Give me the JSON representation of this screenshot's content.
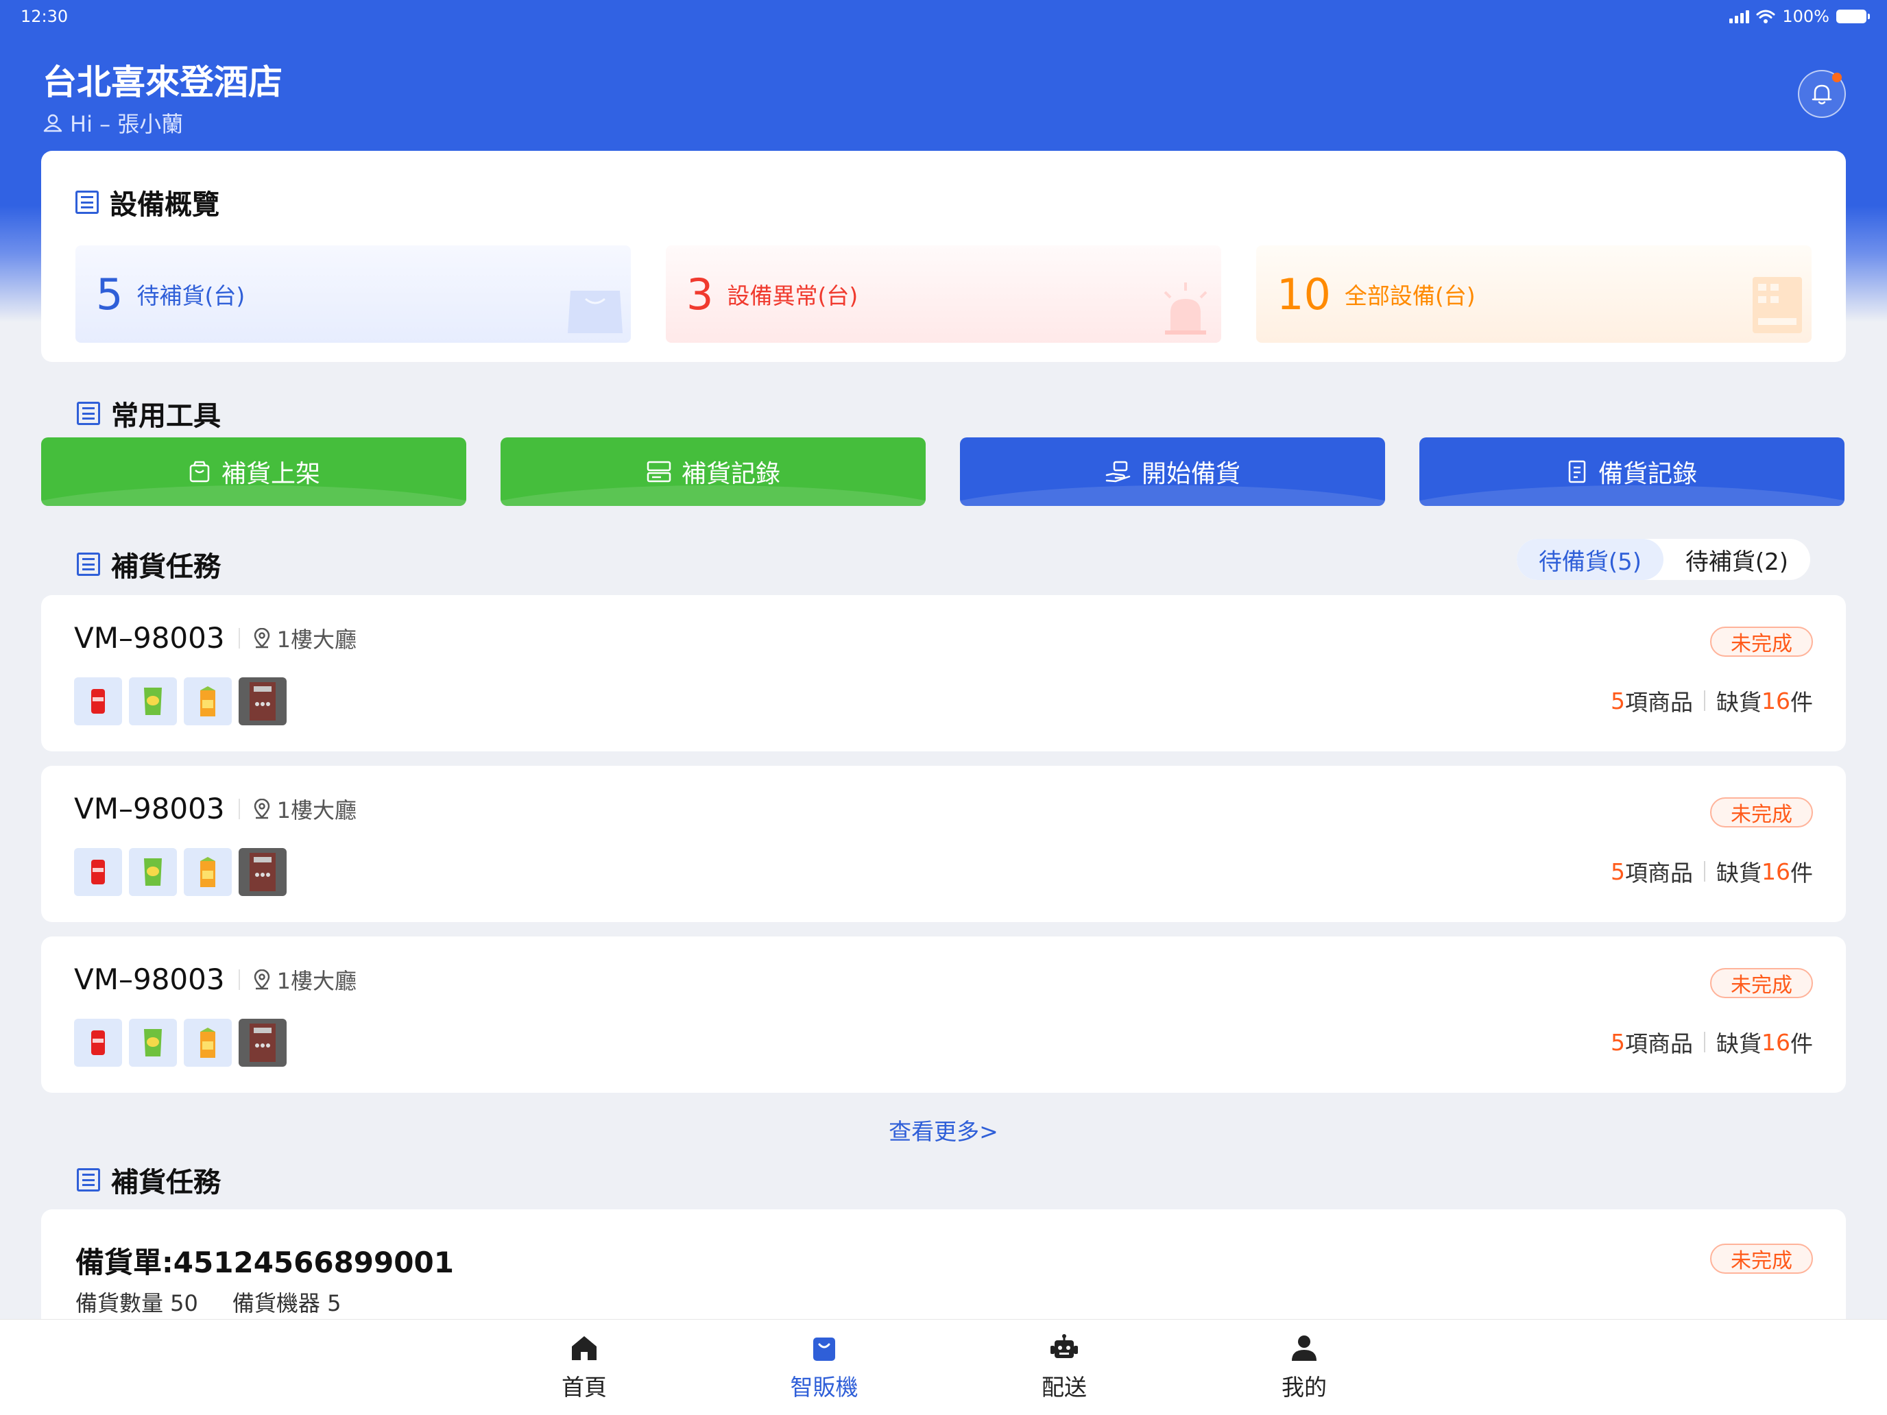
{
  "status_bar": {
    "time": "12:30",
    "battery": "100%"
  },
  "header": {
    "hotel_name": "台北喜來登酒店",
    "greeting": "Hi – 張小蘭"
  },
  "overview": {
    "title": "設備概覽",
    "stats": [
      {
        "value": "5",
        "label": "待補貨(台)",
        "color": "#2f5fd8"
      },
      {
        "value": "3",
        "label": "設備異常(台)",
        "color": "#f03a2e"
      },
      {
        "value": "10",
        "label": "全部設備(台)",
        "color": "#ff8a00"
      }
    ]
  },
  "tools": {
    "title": "常用工具",
    "items": [
      {
        "label": "補貨上架",
        "icon": "bag-icon",
        "color": "#45be3c"
      },
      {
        "label": "補貨記錄",
        "icon": "records-icon",
        "color": "#45be3c"
      },
      {
        "label": "開始備貨",
        "icon": "hand-box-icon",
        "color": "#2f5fe0"
      },
      {
        "label": "備貨記錄",
        "icon": "document-icon",
        "color": "#2f5fe0"
      }
    ]
  },
  "restock_tasks": {
    "title": "補貨任務",
    "tabs": [
      {
        "label": "待備貨(5)",
        "active": true
      },
      {
        "label": "待補貨(2)",
        "active": false
      }
    ],
    "tasks": [
      {
        "id": "VM–98003",
        "location": "1樓大廳",
        "status": "未完成",
        "items_count": "5",
        "items_suffix": "項商品",
        "shortage_prefix": "缺貨",
        "shortage_count": "16",
        "shortage_suffix": "件"
      },
      {
        "id": "VM–98003",
        "location": "1樓大廳",
        "status": "未完成",
        "items_count": "5",
        "items_suffix": "項商品",
        "shortage_prefix": "缺貨",
        "shortage_count": "16",
        "shortage_suffix": "件"
      },
      {
        "id": "VM–98003",
        "location": "1樓大廳",
        "status": "未完成",
        "items_count": "5",
        "items_suffix": "項商品",
        "shortage_prefix": "缺貨",
        "shortage_count": "16",
        "shortage_suffix": "件"
      }
    ],
    "more_link": "查看更多>"
  },
  "prep_tasks": {
    "title": "補貨任務",
    "order": {
      "number": "備貨單:45124566899001",
      "status": "未完成",
      "quantity_label": "備貨數量 50",
      "machines_label": "備貨機器 5"
    }
  },
  "tabbar": {
    "items": [
      {
        "label": "首頁",
        "icon": "home-icon",
        "active": false
      },
      {
        "label": "智販機",
        "icon": "vending-machine-icon",
        "active": true
      },
      {
        "label": "配送",
        "icon": "robot-icon",
        "active": false
      },
      {
        "label": "我的",
        "icon": "profile-icon",
        "active": false
      }
    ]
  }
}
